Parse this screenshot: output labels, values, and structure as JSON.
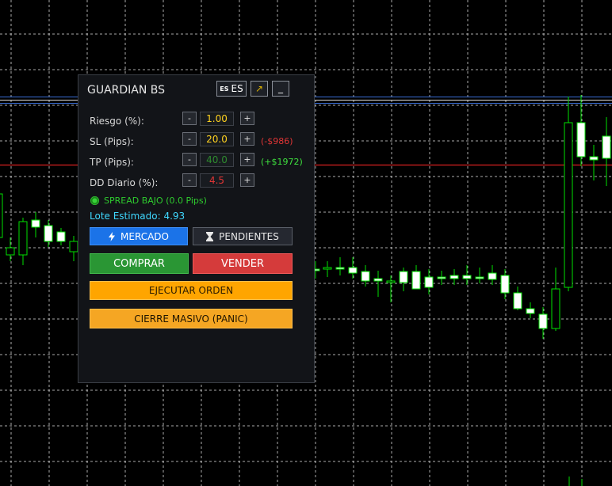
{
  "chart": {
    "grid_color": "#c8c8c8",
    "bull_color": "#00e000",
    "bear_body_color": "#ffffff",
    "level_colors": {
      "line_a": "#3a6fd8",
      "line_b": "#d8d8d8",
      "line_c": "#d82020"
    }
  },
  "panel": {
    "title": "GUARDIAN BS",
    "lang": {
      "flag": "ES",
      "label": "ES"
    },
    "expand_icon": "↗",
    "minimize_label": "_",
    "rows": [
      {
        "label": "Riesgo (%):",
        "value": "1.00",
        "value_color": "#ffd21f",
        "minus": "-",
        "plus": "+",
        "note": ""
      },
      {
        "label": "SL (Pips):",
        "value": "20.0",
        "value_color": "#ffd21f",
        "minus": "-",
        "plus": "+",
        "note": "(-$986)",
        "note_color": "#e03535"
      },
      {
        "label": "TP (Pips):",
        "value": "40.0",
        "value_color": "#2e8b2e",
        "minus": "-",
        "plus": "+",
        "note": "(+$1972)",
        "note_color": "#3ee03e"
      },
      {
        "label": "DD Diario (%):",
        "value": "4.5",
        "value_color": "#e03535",
        "minus": "-",
        "plus": "+",
        "note": ""
      }
    ],
    "spread": "SPREAD BAJO (0.0 Pips)",
    "lote": "Lote Estimado: 4.93",
    "mode_buttons": {
      "mercado": "MERCADO",
      "pendientes": "PENDIENTES"
    },
    "trade_buttons": {
      "comprar": "COMPRAR",
      "vender": "VENDER"
    },
    "ejecutar": "EJECUTAR ORDEN",
    "panic": "CIERRE MASIVO (PANIC)"
  }
}
